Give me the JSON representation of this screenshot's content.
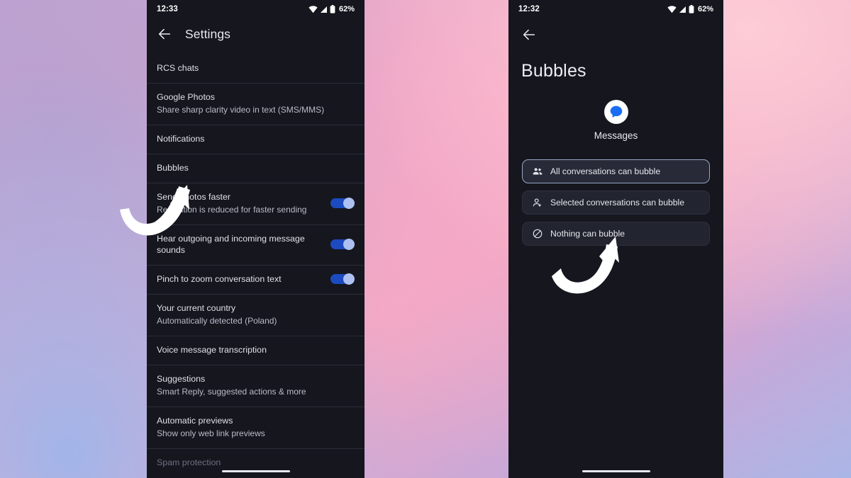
{
  "background": {
    "gradient_colors": [
      "#c3a5d4",
      "#e4a9c8",
      "#f2a9c4",
      "#fdccd6",
      "#aab6e6"
    ]
  },
  "theme": {
    "phone_background": "#15161e",
    "divider": "#2b2d38",
    "primary_text": "#dfe1e8",
    "secondary_text": "#b9bcc7",
    "toggle_track_on": "#1b4bbf",
    "toggle_thumb_on": "#aec0f2",
    "selected_border": "#9aa6c6",
    "card_background": "#22242f",
    "messages_blue": "#1b6ef3"
  },
  "left_phone": {
    "status_bar": {
      "time": "12:33",
      "battery_percent": "62%",
      "icons": [
        "wifi-icon",
        "signal-icon",
        "battery-icon"
      ]
    },
    "appbar": {
      "back_icon": "back-arrow-icon",
      "title": "Settings"
    },
    "rows": [
      {
        "title": "RCS chats",
        "subtitle": "",
        "toggle": null
      },
      {
        "title": "Google Photos",
        "subtitle": "Share sharp clarity video in text (SMS/MMS)",
        "toggle": null
      },
      {
        "title": "Notifications",
        "subtitle": "",
        "toggle": null
      },
      {
        "title": "Bubbles",
        "subtitle": "",
        "toggle": null
      },
      {
        "title": "Send photos faster",
        "subtitle": "Resolution is reduced for faster sending",
        "toggle": "on"
      },
      {
        "title": "Hear outgoing and incoming message sounds",
        "subtitle": "",
        "toggle": "on"
      },
      {
        "title": "Pinch to zoom conversation text",
        "subtitle": "",
        "toggle": "on"
      },
      {
        "title": "Your current country",
        "subtitle": "Automatically detected (Poland)",
        "toggle": null
      },
      {
        "title": "Voice message transcription",
        "subtitle": "",
        "toggle": null
      },
      {
        "title": "Suggestions",
        "subtitle": "Smart Reply, suggested actions & more",
        "toggle": null
      },
      {
        "title": "Automatic previews",
        "subtitle": "Show only web link previews",
        "toggle": null
      },
      {
        "title": "Spam protection",
        "subtitle": "",
        "toggle": null
      }
    ]
  },
  "right_phone": {
    "status_bar": {
      "time": "12:32",
      "battery_percent": "62%",
      "icons": [
        "wifi-icon",
        "signal-icon",
        "battery-icon"
      ]
    },
    "appbar": {
      "back_icon": "back-arrow-icon"
    },
    "page_title": "Bubbles",
    "app": {
      "icon": "messages-app-icon",
      "name": "Messages"
    },
    "options": [
      {
        "label": "All conversations can bubble",
        "icon": "group-people-icon",
        "selected": true
      },
      {
        "label": "Selected conversations can bubble",
        "icon": "person-add-icon",
        "selected": false
      },
      {
        "label": "Nothing can bubble",
        "icon": "block-circle-icon",
        "selected": false
      }
    ]
  },
  "annotations": {
    "left_arrow": {
      "icon": "curved-arrow-up-right",
      "points_to": "Bubbles"
    },
    "right_arrow": {
      "icon": "curved-arrow-up-right",
      "points_to": "All conversations can bubble"
    }
  }
}
